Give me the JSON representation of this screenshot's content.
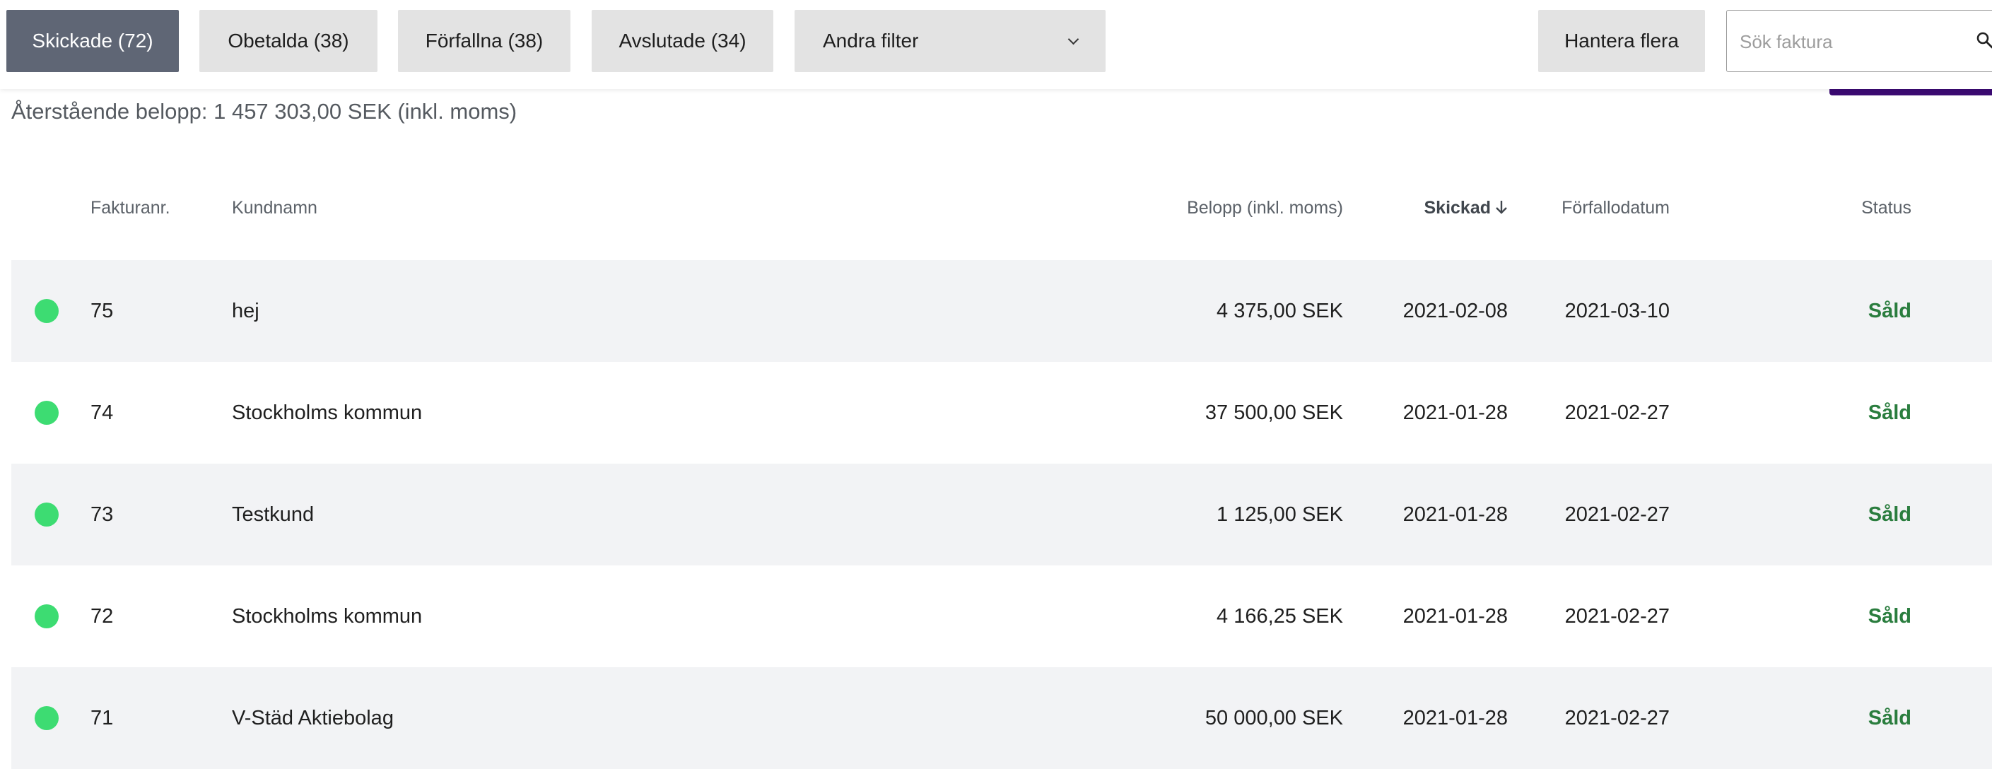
{
  "filters": [
    {
      "label": "Skickade (72)",
      "active": true
    },
    {
      "label": "Obetalda (38)",
      "active": false
    },
    {
      "label": "Förfallna (38)",
      "active": false
    },
    {
      "label": "Avslutade (34)",
      "active": false
    }
  ],
  "other_filter": {
    "label": "Andra filter"
  },
  "manage": {
    "label": "Hantera flera"
  },
  "search": {
    "placeholder": "Sök faktura",
    "value": ""
  },
  "summary": {
    "text": "Återstående belopp: 1 457 303,00 SEK (inkl. moms)"
  },
  "table": {
    "columns": {
      "number": "Fakturanr.",
      "customer": "Kundnamn",
      "amount": "Belopp (inkl. moms)",
      "sent": "Skickad",
      "due": "Förfallodatum",
      "status": "Status"
    },
    "sort_column": "sent",
    "sort_direction": "descending",
    "rows": [
      {
        "number": "75",
        "customer": "hej",
        "amount": "4 375,00 SEK",
        "sent": "2021-02-08",
        "due": "2021-03-10",
        "status": "Såld"
      },
      {
        "number": "74",
        "customer": "Stockholms kommun",
        "amount": "37 500,00 SEK",
        "sent": "2021-01-28",
        "due": "2021-02-27",
        "status": "Såld"
      },
      {
        "number": "73",
        "customer": "Testkund",
        "amount": "1 125,00 SEK",
        "sent": "2021-01-28",
        "due": "2021-02-27",
        "status": "Såld"
      },
      {
        "number": "72",
        "customer": "Stockholms kommun",
        "amount": "4 166,25 SEK",
        "sent": "2021-01-28",
        "due": "2021-02-27",
        "status": "Såld"
      },
      {
        "number": "71",
        "customer": "V-Städ Aktiebolag",
        "amount": "50 000,00 SEK",
        "sent": "2021-01-28",
        "due": "2021-02-27",
        "status": "Såld"
      }
    ]
  },
  "colors": {
    "active_filter": "#5f6675",
    "inactive_filter": "#e3e3e3",
    "status_dot": "#3ddc72",
    "status_text": "#2a7d3e",
    "accent": "#3b0a72",
    "row_shade": "#f2f3f5"
  },
  "icons": {
    "dropdown": "chevron-down-icon",
    "search": "search-icon",
    "sort": "arrow-down-icon",
    "row_status": "status-dot"
  }
}
